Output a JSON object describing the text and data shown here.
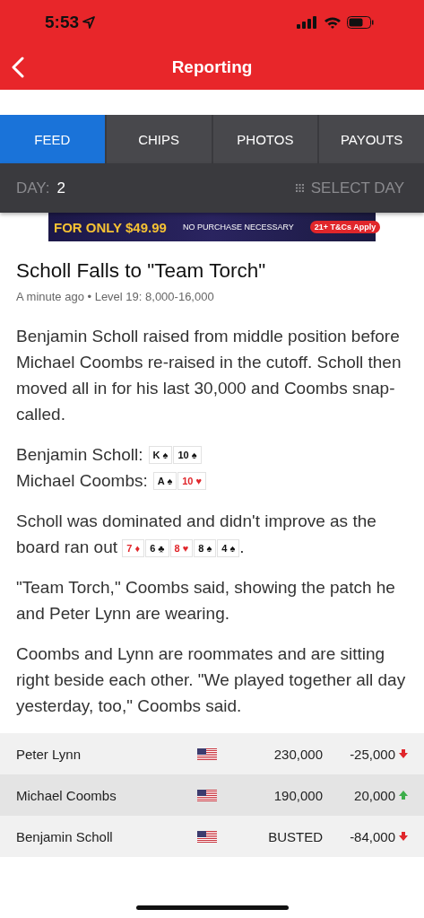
{
  "status_bar": {
    "time": "5:53"
  },
  "nav": {
    "title": "Reporting"
  },
  "tabs": [
    {
      "label": "FEED",
      "selected": true
    },
    {
      "label": "CHIPS",
      "selected": false
    },
    {
      "label": "PHOTOS",
      "selected": false
    },
    {
      "label": "PAYOUTS",
      "selected": false
    }
  ],
  "day_bar": {
    "label": "DAY:",
    "value": "2",
    "select": "SELECT DAY"
  },
  "ad": {
    "price": "FOR ONLY $49.99",
    "note": "NO PURCHASE NECESSARY",
    "badge": "21+ T&Cs Apply"
  },
  "post": {
    "title": "Scholl Falls to \"Team Torch\"",
    "meta": "A minute ago • Level 19: 8,000-16,000",
    "blocks": [
      {
        "kind": "paragraph",
        "text": "Benjamin Scholl raised from middle position before Michael Coombs re-raised in the cutoff. Scholl then moved all in for his last 30,000 and Coombs snap-called."
      },
      {
        "kind": "hands",
        "hands": [
          {
            "player": "Benjamin Scholl:",
            "cards": [
              {
                "rank": "K",
                "suit": "♠",
                "color": "#111111"
              },
              {
                "rank": "10",
                "suit": "♠",
                "color": "#111111"
              }
            ]
          },
          {
            "player": "Michael Coombs:",
            "cards": [
              {
                "rank": "A",
                "suit": "♠",
                "color": "#111111"
              },
              {
                "rank": "10",
                "suit": "♥",
                "color": "#e0262b"
              }
            ]
          }
        ]
      },
      {
        "kind": "board",
        "lines": [
          "Scholl was dominated and didn't improve as the",
          "board ran out"
        ],
        "end": ".",
        "cards": [
          {
            "rank": "7",
            "suit": "♦",
            "color": "#e0262b"
          },
          {
            "rank": "6",
            "suit": "♣",
            "color": "#111111"
          },
          {
            "rank": "8",
            "suit": "♥",
            "color": "#e0262b"
          },
          {
            "rank": "8",
            "suit": "♠",
            "color": "#111111"
          },
          {
            "rank": "4",
            "suit": "♠",
            "color": "#111111"
          }
        ]
      },
      {
        "kind": "paragraph",
        "text": "\"Team Torch,\" Coombs said, showing the patch he and Peter Lynn are wearing."
      },
      {
        "kind": "paragraph",
        "text": "Coombs and Lynn are roommates and are sitting right beside each other. \"We played together all day yesterday, too,\" Coombs said."
      }
    ]
  },
  "chip_counts": [
    {
      "name": "Peter Lynn",
      "stack": "230,000",
      "change": "-25,000",
      "kind": "down"
    },
    {
      "name": "Michael Coombs",
      "stack": "190,000",
      "change": "20,000",
      "kind": "up"
    },
    {
      "name": "Benjamin Scholl",
      "stack": "BUSTED",
      "change": "-84,000",
      "kind": "down"
    }
  ]
}
